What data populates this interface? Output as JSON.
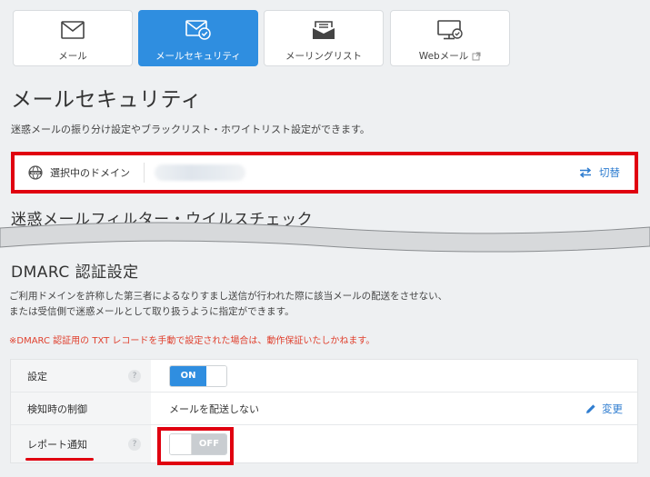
{
  "tabs": [
    {
      "label": "メール",
      "icon": "envelope-icon",
      "active": false
    },
    {
      "label": "メールセキュリティ",
      "icon": "envelope-shield-icon",
      "active": true
    },
    {
      "label": "メーリングリスト",
      "icon": "mailing-list-icon",
      "active": false
    },
    {
      "label": "Webメール",
      "icon": "webmail-monitor-icon",
      "active": false,
      "external": true
    }
  ],
  "page": {
    "title": "メールセキュリティ",
    "description": "迷惑メールの振り分け設定やブラックリスト・ホワイトリスト設定ができます。"
  },
  "domain": {
    "label": "選択中のドメイン",
    "switch_label": "切替"
  },
  "cut_section_title": "迷惑メールフィルター・ウイルスチェック",
  "dmarc": {
    "title": "DMARC 認証設定",
    "desc_line1": "ご利用ドメインを許称した第三者によるなりすまし送信が行われた際に該当メールの配送をさせない、",
    "desc_line2": "または受信側で迷惑メールとして取り扱うように指定ができます。",
    "warning": "※DMARC 認証用の TXT レコードを手動で設定された場合は、動作保証いたしかねます。"
  },
  "settings": {
    "rows": [
      {
        "key": "設定",
        "help": "?",
        "toggle": "ON"
      },
      {
        "key": "検知時の制御",
        "value": "メールを配送しない",
        "edit_label": "変更"
      },
      {
        "key": "レポート通知",
        "help": "?",
        "toggle": "OFF"
      }
    ]
  },
  "colors": {
    "accent": "#2f8ee0",
    "highlight": "#e00010",
    "warning": "#e0412f"
  }
}
